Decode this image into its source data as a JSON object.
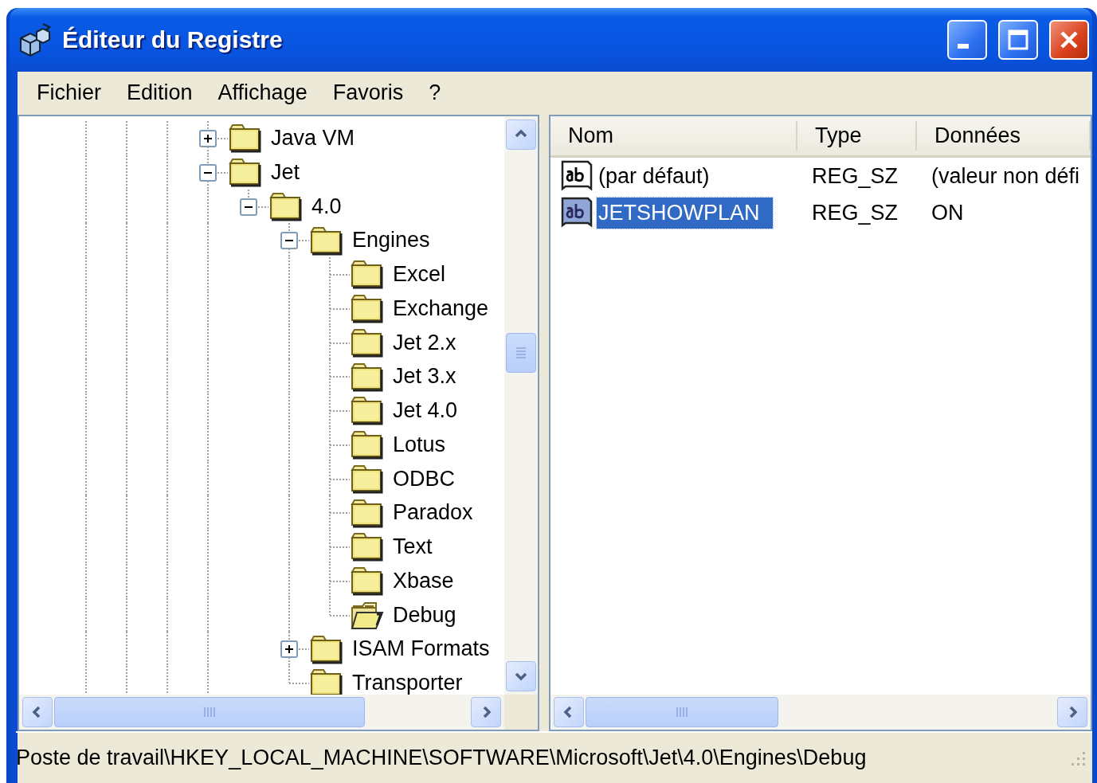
{
  "window": {
    "title": "Éditeur du Registre"
  },
  "menu": [
    "Fichier",
    "Edition",
    "Affichage",
    "Favoris",
    "?"
  ],
  "tree": [
    {
      "label": "Java VM",
      "expanded": false,
      "selected": false
    },
    {
      "label": "Jet",
      "expanded": true,
      "selected": false,
      "children": [
        {
          "label": "4.0",
          "expanded": true,
          "selected": false,
          "children": [
            {
              "label": "Engines",
              "expanded": true,
              "selected": false,
              "children": [
                {
                  "label": "Excel",
                  "selected": false
                },
                {
                  "label": "Exchange",
                  "selected": false
                },
                {
                  "label": "Jet 2.x",
                  "selected": false
                },
                {
                  "label": "Jet 3.x",
                  "selected": false
                },
                {
                  "label": "Jet 4.0",
                  "selected": false
                },
                {
                  "label": "Lotus",
                  "selected": false
                },
                {
                  "label": "ODBC",
                  "selected": false
                },
                {
                  "label": "Paradox",
                  "selected": false
                },
                {
                  "label": "Text",
                  "selected": false
                },
                {
                  "label": "Xbase",
                  "selected": false
                },
                {
                  "label": "Debug",
                  "selected": true
                }
              ]
            },
            {
              "label": "ISAM Formats",
              "expanded": false,
              "selected": false
            },
            {
              "label": "Transporter",
              "selected": false
            }
          ]
        }
      ],
      "continues": true
    }
  ],
  "table": {
    "columns": [
      "Nom",
      "Type",
      "Données"
    ],
    "rows": [
      {
        "name": "(par défaut)",
        "type": "REG_SZ",
        "data": "(valeur non défi",
        "selected": false
      },
      {
        "name": "JETSHOWPLAN",
        "type": "REG_SZ",
        "data": "ON",
        "selected": true
      }
    ]
  },
  "status_bar": "Poste de travail\\HKEY_LOCAL_MACHINE\\SOFTWARE\\Microsoft\\Jet\\4.0\\Engines\\Debug"
}
